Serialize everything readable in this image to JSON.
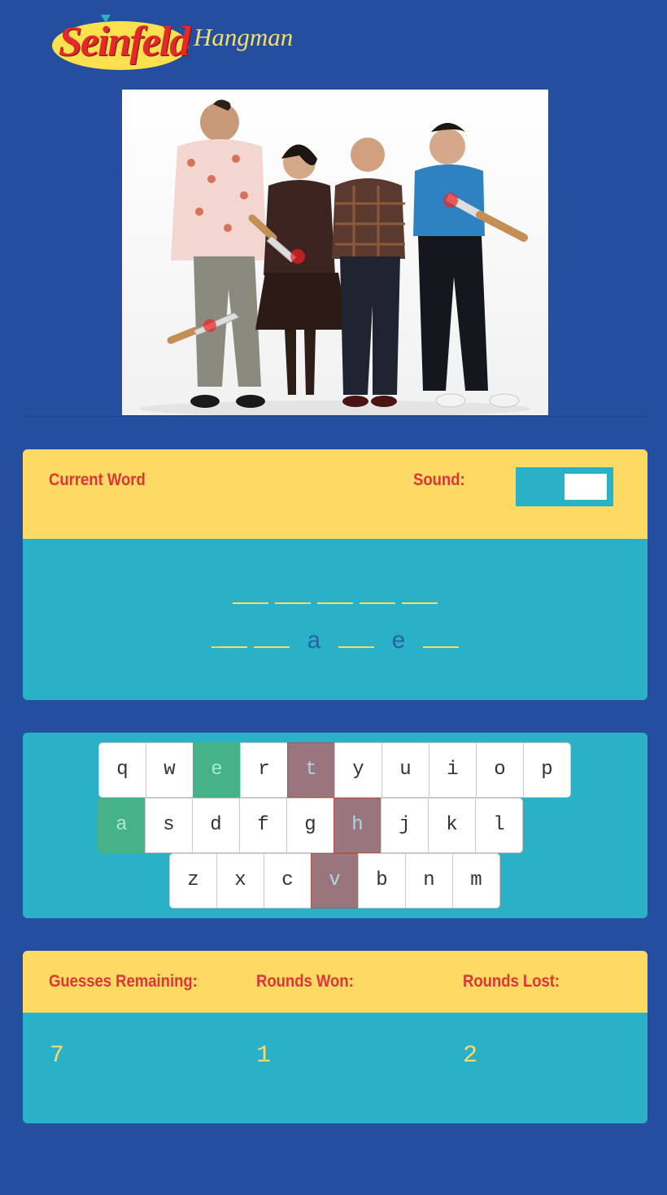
{
  "header": {
    "logo_main": "Seinfeld",
    "logo_sub": "Hangman"
  },
  "word_panel": {
    "title": "Current Word",
    "sound_label": "Sound:",
    "sound_enabled": false,
    "rows": [
      [
        "",
        "",
        "",
        "",
        ""
      ],
      [
        "",
        "",
        "a",
        "",
        "e",
        ""
      ]
    ]
  },
  "keyboard": {
    "rows": [
      [
        {
          "k": "q",
          "s": ""
        },
        {
          "k": "w",
          "s": ""
        },
        {
          "k": "e",
          "s": "correct"
        },
        {
          "k": "r",
          "s": ""
        },
        {
          "k": "t",
          "s": "wrong"
        },
        {
          "k": "y",
          "s": ""
        },
        {
          "k": "u",
          "s": ""
        },
        {
          "k": "i",
          "s": ""
        },
        {
          "k": "o",
          "s": ""
        },
        {
          "k": "p",
          "s": ""
        }
      ],
      [
        {
          "k": "a",
          "s": "correct"
        },
        {
          "k": "s",
          "s": ""
        },
        {
          "k": "d",
          "s": ""
        },
        {
          "k": "f",
          "s": ""
        },
        {
          "k": "g",
          "s": ""
        },
        {
          "k": "h",
          "s": "wrong"
        },
        {
          "k": "j",
          "s": ""
        },
        {
          "k": "k",
          "s": ""
        },
        {
          "k": "l",
          "s": ""
        }
      ],
      [
        {
          "k": "z",
          "s": ""
        },
        {
          "k": "x",
          "s": ""
        },
        {
          "k": "c",
          "s": ""
        },
        {
          "k": "v",
          "s": "wrong"
        },
        {
          "k": "b",
          "s": ""
        },
        {
          "k": "n",
          "s": ""
        },
        {
          "k": "m",
          "s": ""
        }
      ]
    ]
  },
  "stats": {
    "guesses_label": "Guesses Remaining:",
    "won_label": "Rounds Won:",
    "lost_label": "Rounds Lost:",
    "guesses": "7",
    "won": "1",
    "lost": "2"
  },
  "colors": {
    "background": "#244f9e",
    "panel_teal": "#2ab1c8",
    "panel_yellow": "#fcda64",
    "label_red": "#e0343a",
    "correct_key": "#45b287",
    "wrong_key": "#9b757d"
  }
}
